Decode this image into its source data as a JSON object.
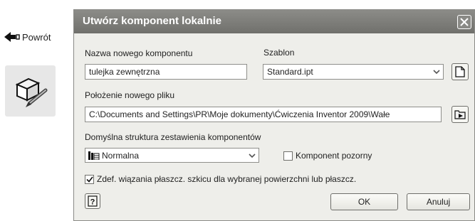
{
  "left_panel": {
    "back_label": "Powrót",
    "icons": {
      "back": "arrow-left-icon",
      "tool": "create-component-icon"
    }
  },
  "dialog": {
    "title": "Utwórz komponent lokalnie",
    "close_icon": "close-icon",
    "name_label": "Nazwa nowego komponentu",
    "name_value": "tulejka zewnętrzna",
    "template_label": "Szablon",
    "template_value": "Standard.ipt",
    "new_file_icon": "new-document-icon",
    "location_label": "Położenie nowego pliku",
    "location_value": "C:\\Documents and Settings\\PR\\Moje dokumenty\\Ćwiczenia Inventor 2009\\Wałe",
    "browse_icon": "browse-folder-icon",
    "bom_label": "Domyślna struktura zestawienia komponentów",
    "bom_value": "Normalna",
    "bom_icon": "bom-structure-icon",
    "virtual_label": "Komponent pozorny",
    "virtual_checked": false,
    "constraint_label": "Zdef. wiązania płaszcz. szkicu dla wybranej powierzchni lub płaszcz.",
    "constraint_checked": true,
    "help_icon": "help-icon",
    "ok_label": "OK",
    "cancel_label": "Anuluj"
  },
  "colors": {
    "titlebar": "#7d7d79",
    "dialog_bg": "#eeeeea",
    "tool_tile": "#e7e7e7"
  }
}
